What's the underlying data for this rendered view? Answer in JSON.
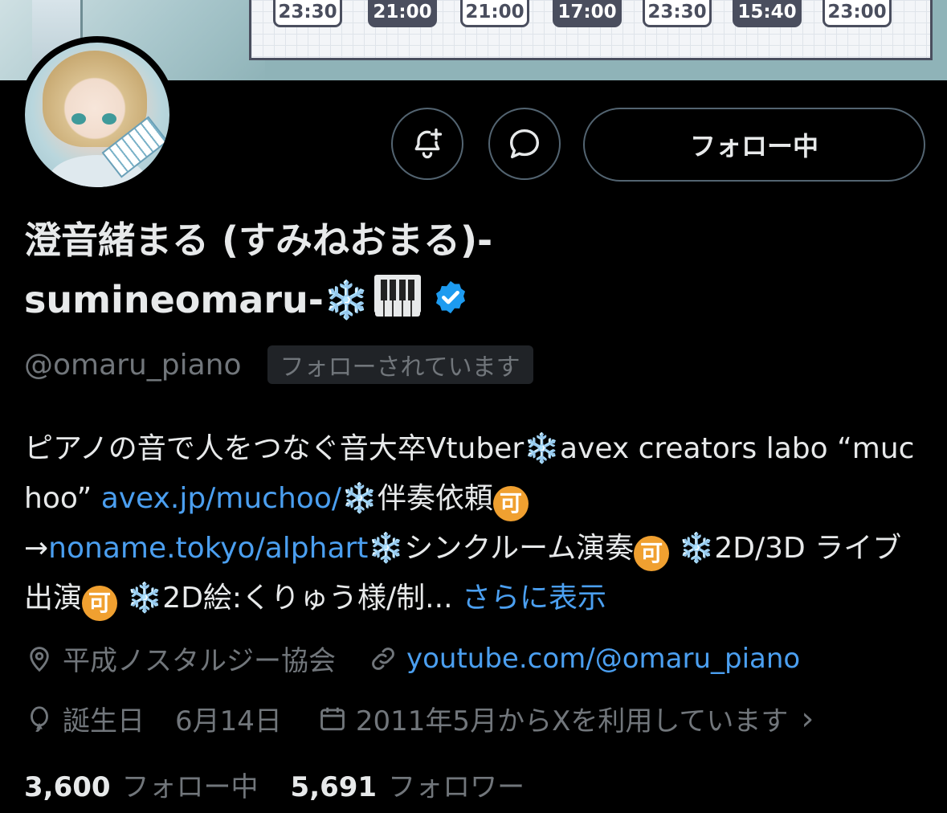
{
  "banner": {
    "times": [
      "23:30",
      "21:00",
      "21:00",
      "17:00",
      "23:30",
      "15:40",
      "23:00"
    ],
    "time_styles": [
      "light",
      "dark",
      "light",
      "dark",
      "light",
      "dark",
      "light"
    ]
  },
  "actions": {
    "notify_icon": "bell-plus-icon",
    "message_icon": "chat-bubble-icon",
    "follow_label": "フォロー中"
  },
  "profile": {
    "name_line1": "澄音緒まる (すみねおまる)-",
    "name_line2": "sumineomaru-",
    "snow_emoji": "❄️",
    "handle": "@omaru_piano",
    "follows_you": "フォローされています"
  },
  "bio": {
    "p1": "ピアノの音で人をつなぐ音大卒Vtuber",
    "p2": "avex creators labo “muchoo” ",
    "link1": "avex.jp/muchoo/",
    "p3": "伴奏依頼",
    "arrow": "→",
    "link2": "noname.tokyo/alphart",
    "p4": "シンクルーム演奏",
    "p5": " ",
    "p6": "2D/3D ライブ出演",
    "p7": "2D絵:くりゅう様/制...",
    "ka": "可",
    "more": "さらに表示"
  },
  "meta": {
    "location": "平成ノスタルジー協会",
    "website": "youtube.com/@omaru_piano",
    "birthday_label": "誕生日",
    "birthday": "6月14日",
    "joined": "2011年5月からXを利用しています",
    "chevron": "›"
  },
  "stats": {
    "following_count": "3,600",
    "following_label": "フォロー中",
    "followers_count": "5,691",
    "followers_label": "フォロワー"
  },
  "colors": {
    "background": "#000000",
    "text": "#e7e9ea",
    "muted": "#71767b",
    "link": "#4b9ff0",
    "verified": "#1d9bf0",
    "ka_badge": "#f0a030"
  }
}
